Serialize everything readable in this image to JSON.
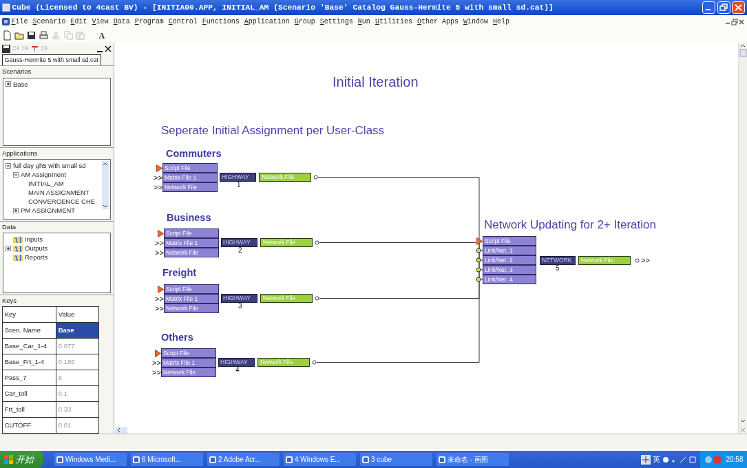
{
  "window": {
    "title": "Cube (Licensed to 4cast BV) - [INITIA00.APP, INITIAL_AM (Scenario 'Base' Catalog Gauss-Hermite 5 with small sd.cat)]"
  },
  "menu_bar": [
    "File",
    "Scenario",
    "Edit",
    "View",
    "Data",
    "Program",
    "Control",
    "Functions",
    "Application",
    "Group",
    "Settings",
    "Run",
    "Utilities",
    "Other Apps",
    "Window",
    "Help"
  ],
  "toolbar": [
    {
      "kind": "new",
      "disabled": false
    },
    {
      "kind": "open",
      "disabled": false
    },
    {
      "kind": "save",
      "disabled": false
    },
    {
      "kind": "print",
      "disabled": false
    },
    {
      "kind": "cut",
      "disabled": true
    },
    {
      "kind": "copy",
      "disabled": true
    },
    {
      "kind": "paste",
      "disabled": true
    }
  ],
  "toolbar_label": "A",
  "left_panel": {
    "tab": "Gauss-Hermite 5 with small sd.cat",
    "scenarios": {
      "title": "Scenarios",
      "items": [
        {
          "label": "Base",
          "expanded": false
        }
      ]
    },
    "applications": {
      "title": "Applications",
      "items": [
        {
          "label": "full day gh5 with small sd",
          "expanded": true,
          "children": [
            {
              "label": "AM Assignment",
              "expanded": true,
              "children": [
                {
                  "label": "INITIAL_AM"
                },
                {
                  "label": "MAIN ASSIGNMENT"
                },
                {
                  "label": "CONVERGENCE CHE"
                }
              ]
            },
            {
              "label": "PM ASSIGNMENT",
              "expanded": false
            }
          ]
        }
      ]
    },
    "data": {
      "title": "Data",
      "items": [
        {
          "label": "Inputs"
        },
        {
          "label": "Outputs",
          "expanded": false
        },
        {
          "label": "Reports"
        }
      ]
    },
    "keys": {
      "title": "Keys",
      "columns": [
        "Key",
        "Value"
      ],
      "rows": [
        {
          "key": "Scen. Name",
          "value": "Base",
          "selected": true
        },
        {
          "key": "Base_Car_1-4",
          "value": "0.077",
          "selected": false
        },
        {
          "key": "Base_Frt_1-4",
          "value": "0.185",
          "selected": false
        },
        {
          "key": "Pass_7",
          "value": "5",
          "selected": false
        },
        {
          "key": "Car_toll",
          "value": "0.1",
          "selected": false
        },
        {
          "key": "Frt_toll",
          "value": "0.33",
          "selected": false
        },
        {
          "key": "CUTOFF",
          "value": "0.01",
          "selected": false
        }
      ]
    }
  },
  "canvas": {
    "title": "Initial Iteration",
    "subtitle": "Seperate Initial Assignment per User-Class",
    "groups": [
      {
        "title": "Commuters",
        "inputs": [
          {
            "kind": "script",
            "label": "Script File"
          },
          {
            "kind": "matrix",
            "marker": ">>",
            "label": "Matrix File 1"
          },
          {
            "kind": "matrix",
            "marker": ">>",
            "label": "Network File"
          }
        ],
        "program": {
          "name": "HIGHWAY",
          "number": "1"
        },
        "output": "Network File"
      },
      {
        "title": "Business",
        "inputs": [
          {
            "kind": "script",
            "label": "Script File"
          },
          {
            "kind": "matrix",
            "marker": ">>",
            "label": "Matrix File 1"
          },
          {
            "kind": "matrix",
            "marker": ">>",
            "label": "Network File"
          }
        ],
        "program": {
          "name": "HIGHWAY",
          "number": "2"
        },
        "output": "Network File"
      },
      {
        "title": "Freight",
        "inputs": [
          {
            "kind": "script",
            "label": "Script File"
          },
          {
            "kind": "matrix",
            "marker": ">>",
            "label": "Matrix File 1"
          },
          {
            "kind": "matrix",
            "marker": ">>",
            "label": "Network File"
          }
        ],
        "program": {
          "name": "HIGHWAY",
          "number": "3"
        },
        "output": "Network File"
      },
      {
        "title": "Others",
        "inputs": [
          {
            "kind": "script",
            "label": "Script File"
          },
          {
            "kind": "matrix",
            "marker": ">>",
            "label": "Matrix File 1"
          },
          {
            "kind": "matrix",
            "marker": ">>",
            "label": "Network File"
          }
        ],
        "program": {
          "name": "HIGHWAY",
          "number": "4"
        },
        "output": "Network File"
      }
    ],
    "update": {
      "title": "Network Updating for 2+ Iteration",
      "inputs": [
        {
          "kind": "script",
          "label": "Script File"
        },
        {
          "kind": "link",
          "label": "Link/Net. 1"
        },
        {
          "kind": "link",
          "label": "Link/Net. 2"
        },
        {
          "kind": "link",
          "label": "Link/Net. 3"
        },
        {
          "kind": "link",
          "label": "Link/Net. 4"
        }
      ],
      "program": {
        "name": "NETWORK",
        "number": "5"
      },
      "output": "Network File",
      "output_marker": ">>"
    }
  },
  "taskbar": {
    "start": "开始",
    "tasks": [
      "Windows Medi...",
      "6 Microsoft...",
      "2 Adobe Acr...",
      "4 Windows E...",
      "3 cube",
      "未命名 - 画图"
    ],
    "ime": "英",
    "clock": "20:58"
  }
}
